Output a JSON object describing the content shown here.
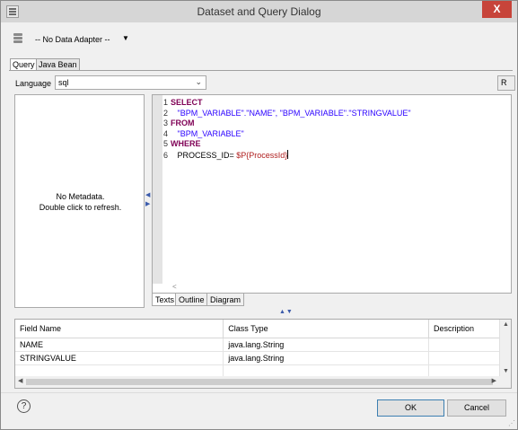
{
  "window": {
    "title": "Dataset and Query Dialog",
    "close_label": "X"
  },
  "toolbar": {
    "adapter_label": "-- No Data Adapter --",
    "adapter_dropdown_glyph": "▼",
    "icon": "database-adapter-icon"
  },
  "tabs": [
    {
      "label": "Query",
      "active": true
    },
    {
      "label": "Java Bean",
      "active": false
    }
  ],
  "language": {
    "label": "Language",
    "value": "sql",
    "arrow": "⌄"
  },
  "right_button": {
    "label": "R"
  },
  "metadata": {
    "line1": "No Metadata.",
    "line2": "Double click to refresh."
  },
  "editor": {
    "lines": [
      {
        "num": "1",
        "parts": [
          {
            "t": "SELECT",
            "c": "kw"
          }
        ]
      },
      {
        "num": "2",
        "parts": [
          {
            "t": "   \"BPM_VARIABLE\".\"NAME\", \"BPM_VARIABLE\".\"STRINGVALUE\"",
            "c": "str"
          }
        ]
      },
      {
        "num": "3",
        "parts": [
          {
            "t": "FROM",
            "c": "kw"
          }
        ]
      },
      {
        "num": "4",
        "parts": [
          {
            "t": "   \"BPM_VARIABLE\"",
            "c": "str"
          }
        ]
      },
      {
        "num": "5",
        "parts": [
          {
            "t": "WHERE",
            "c": "kw"
          }
        ]
      },
      {
        "num": "6",
        "parts": [
          {
            "t": "   PROCESS_ID= ",
            "c": "plain"
          },
          {
            "t": "$P{ProcessId}",
            "c": "param"
          }
        ]
      }
    ],
    "tabs": [
      {
        "label": "Texts",
        "active": true
      },
      {
        "label": "Outline",
        "active": false
      },
      {
        "label": "Diagram",
        "active": false
      }
    ]
  },
  "fields": {
    "columns": [
      "Field Name",
      "Class Type",
      "Description"
    ],
    "rows": [
      [
        "NAME",
        "java.lang.String",
        ""
      ],
      [
        "STRINGVALUE",
        "java.lang.String",
        ""
      ]
    ]
  },
  "footer": {
    "help_glyph": "?",
    "ok_label": "OK",
    "cancel_label": "Cancel"
  },
  "colors": {
    "close_button": "#c7443a",
    "keyword": "#7f0055",
    "string": "#2a00ff",
    "parameter": "#b02020",
    "ok_border": "#3c7fb1"
  }
}
